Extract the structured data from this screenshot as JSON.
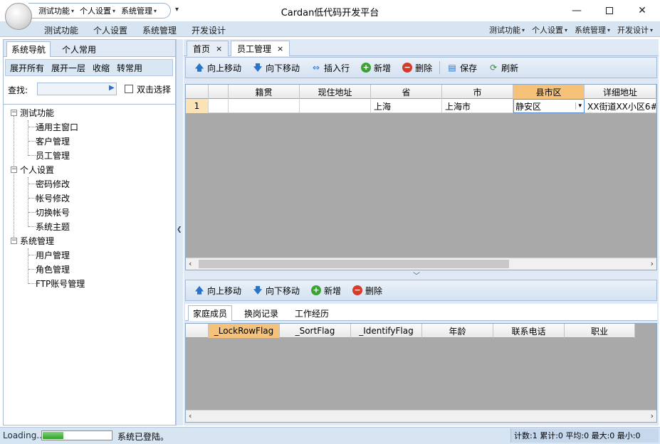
{
  "window": {
    "title": "Cardan低代码开发平台",
    "controls": [
      "minimize",
      "maximize",
      "close"
    ]
  },
  "quick_access": {
    "items": [
      "测试功能",
      "个人设置",
      "系统管理"
    ],
    "more": "▾"
  },
  "ribbon": {
    "tabs": [
      "测试功能",
      "个人设置",
      "系统管理",
      "开发设计"
    ],
    "right_menus": [
      "测试功能",
      "个人设置",
      "系统管理",
      "开发设计"
    ]
  },
  "left_panel": {
    "tabs": [
      "系统导航",
      "个人常用"
    ],
    "toolbar": [
      "展开所有",
      "展开一层",
      "收缩",
      "转常用"
    ],
    "search_label": "查找:",
    "search_value": "",
    "double_click_label": "双击选择",
    "tree": [
      {
        "label": "测试功能",
        "children": [
          "通用主窗口",
          "客户管理",
          "员工管理"
        ]
      },
      {
        "label": "个人设置",
        "children": [
          "密码修改",
          "帐号修改",
          "切换帐号",
          "系统主题"
        ]
      },
      {
        "label": "系统管理",
        "children": [
          "用户管理",
          "角色管理",
          "FTP账号管理"
        ]
      }
    ]
  },
  "doc_tabs": [
    {
      "label": "首页",
      "close": "×"
    },
    {
      "label": "员工管理",
      "close": "×"
    }
  ],
  "top_toolbar": {
    "move_up": "向上移动",
    "move_down": "向下移动",
    "insert_row": "插入行",
    "add": "新增",
    "delete": "删除",
    "save": "保存",
    "refresh": "刷新"
  },
  "grid1": {
    "headers": [
      "",
      "",
      "籍贯",
      "现住地址",
      "省",
      "市",
      "县市区",
      "详细地址"
    ],
    "rows": [
      [
        "1",
        "",
        "",
        "",
        "上海",
        "上海市",
        "静安区",
        "XX街道XX小区6#"
      ]
    ]
  },
  "bottom_toolbar": {
    "move_up": "向上移动",
    "move_down": "向下移动",
    "add": "新增",
    "delete": "删除"
  },
  "sub_tabs": [
    "家庭成员",
    "换岗记录",
    "工作经历"
  ],
  "grid2": {
    "headers": [
      "",
      "_LockRowFlag",
      "_SortFlag",
      "_IdentifyFlag",
      "年龄",
      "联系电话",
      "职业"
    ]
  },
  "status": {
    "loading": "Loading...",
    "progress": 0.3,
    "message": "系统已登陆。",
    "stats": "计数:1 累计:0 平均:0 最大:0 最小:0"
  },
  "colors": {
    "ribbon_bg": "#d7e4f2",
    "selected_header": "#f6c27a",
    "row_number": "#fbe3b5",
    "grid_empty": "#a9a9a9"
  }
}
